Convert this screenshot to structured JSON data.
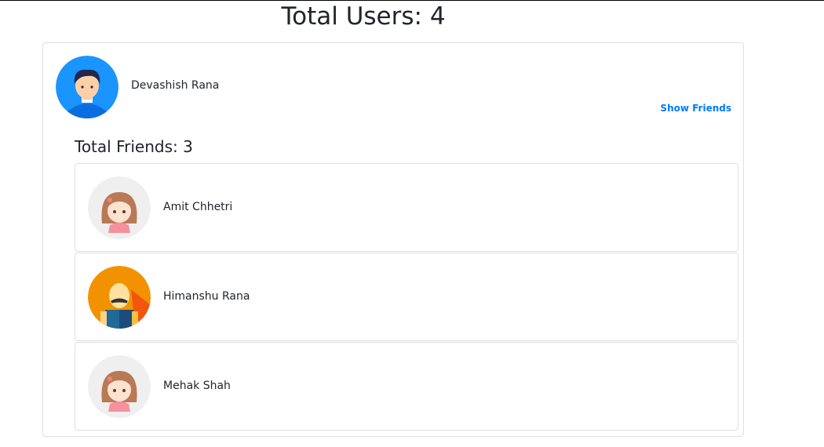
{
  "header": {
    "title": "Total Users: 4"
  },
  "user": {
    "name": "Devashish Rana",
    "avatar_icon": "boy-avatar-icon",
    "show_friends_label": "Show Friends",
    "accent": "#007bff"
  },
  "friends": {
    "title": "Total Friends: 3",
    "items": [
      {
        "name": "Amit Chhetri",
        "avatar_icon": "girl-avatar-icon"
      },
      {
        "name": "Himanshu Rana",
        "avatar_icon": "mustache-man-avatar-icon"
      },
      {
        "name": "Mehak Shah",
        "avatar_icon": "girl-avatar-icon"
      }
    ]
  }
}
